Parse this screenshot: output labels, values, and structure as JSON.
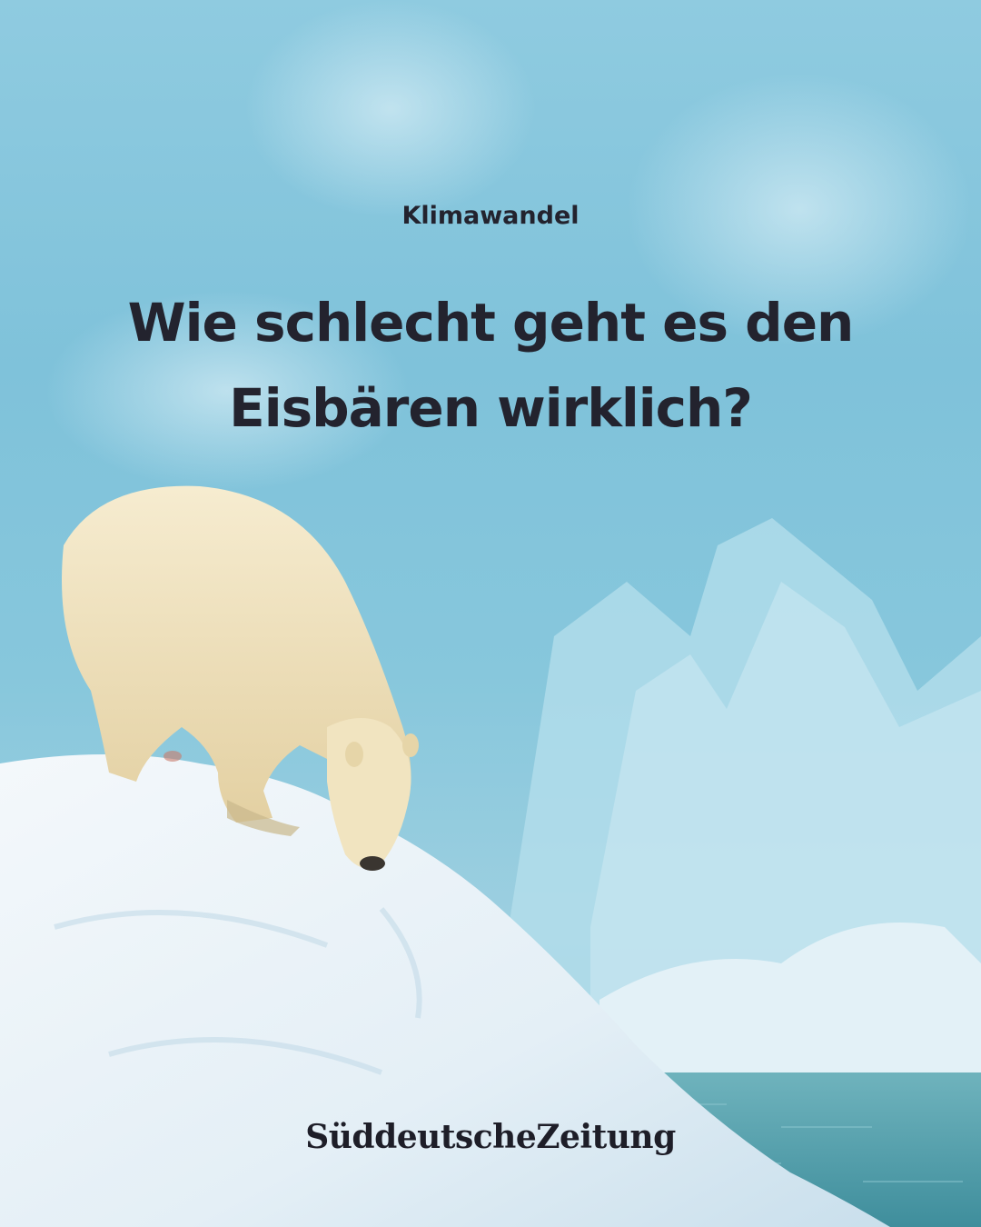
{
  "kicker": "Klimawandel",
  "headline": {
    "line1": "Wie schlecht geht es den",
    "line2": "Eisbären wirklich?"
  },
  "brand": {
    "logo_text": "SüddeutscheZeitung"
  },
  "colors": {
    "ice_blue": "#8fcbe0",
    "snow": "#eaf3f8",
    "bear_fur": "#efe2bc",
    "sea": "#4f9aa6",
    "text": "#23232e"
  }
}
